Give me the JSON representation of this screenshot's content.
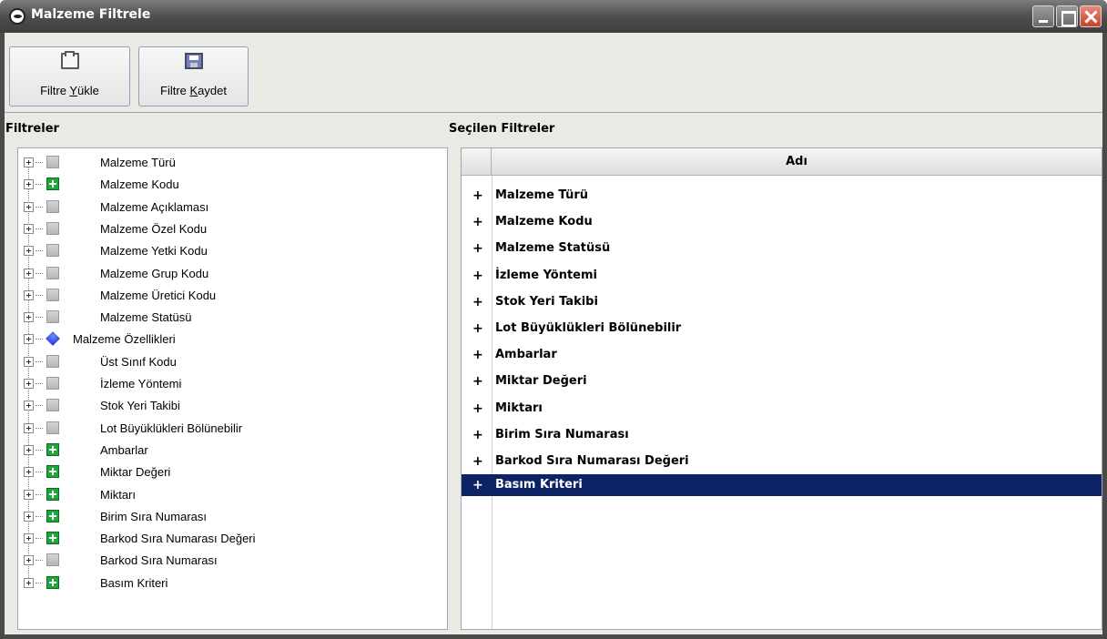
{
  "window": {
    "title": "Malzeme Filtrele"
  },
  "toolbar": {
    "load_prefix": "Filtre ",
    "load_accel": "Y",
    "load_suffix": "ükle",
    "save_prefix": "Filtre ",
    "save_accel": "K",
    "save_suffix": "aydet"
  },
  "filters_panel": {
    "title": "Filtreler",
    "items": [
      {
        "label": "Malzeme Türü",
        "icon": "gray-square"
      },
      {
        "label": "Malzeme Kodu",
        "icon": "green-plus"
      },
      {
        "label": "Malzeme Açıklaması",
        "icon": "gray-square"
      },
      {
        "label": "Malzeme Özel Kodu",
        "icon": "gray-square"
      },
      {
        "label": "Malzeme Yetki Kodu",
        "icon": "gray-square"
      },
      {
        "label": "Malzeme Grup Kodu",
        "icon": "gray-square"
      },
      {
        "label": "Malzeme Üretici Kodu",
        "icon": "gray-square"
      },
      {
        "label": "Malzeme Statüsü",
        "icon": "gray-square"
      },
      {
        "label": "Malzeme Özellikleri",
        "icon": "blue-diamond"
      },
      {
        "label": "Üst Sınıf Kodu",
        "icon": "gray-square"
      },
      {
        "label": "İzleme Yöntemi",
        "icon": "gray-square"
      },
      {
        "label": "Stok Yeri Takibi",
        "icon": "gray-square"
      },
      {
        "label": "Lot Büyüklükleri Bölünebilir",
        "icon": "gray-square"
      },
      {
        "label": "Ambarlar",
        "icon": "green-plus"
      },
      {
        "label": "Miktar Değeri",
        "icon": "green-plus"
      },
      {
        "label": "Miktarı",
        "icon": "green-plus"
      },
      {
        "label": "Birim Sıra Numarası",
        "icon": "green-plus"
      },
      {
        "label": "Barkod Sıra Numarası Değeri",
        "icon": "green-plus"
      },
      {
        "label": "Barkod Sıra Numarası",
        "icon": "gray-square"
      },
      {
        "label": "Basım Kriteri",
        "icon": "green-plus"
      }
    ]
  },
  "selected_panel": {
    "title": "Seçilen Filtreler",
    "column_header": "Adı",
    "row_marker": "+",
    "selected_color": "#0c2466",
    "rows": [
      {
        "name": "Malzeme Türü"
      },
      {
        "name": "Malzeme Kodu"
      },
      {
        "name": "Malzeme Statüsü"
      },
      {
        "name": "İzleme Yöntemi"
      },
      {
        "name": "Stok Yeri Takibi"
      },
      {
        "name": "Lot Büyüklükleri Bölünebilir"
      },
      {
        "name": "Ambarlar"
      },
      {
        "name": "Miktar Değeri"
      },
      {
        "name": "Miktarı"
      },
      {
        "name": "Birim Sıra Numarası"
      },
      {
        "name": "Barkod Sıra Numarası Değeri"
      },
      {
        "name": "Basım Kriteri",
        "selected": true
      }
    ]
  }
}
